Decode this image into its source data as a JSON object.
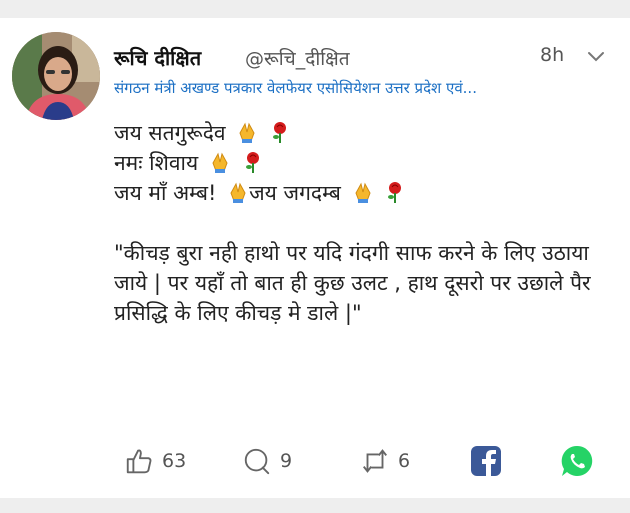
{
  "user": {
    "name": "रूचि दीक्षित",
    "handle": "@रूचि_दीक्षित",
    "time": "8h",
    "bio": "संगठन मंत्री अखण्ड पत्रकार वेलफेयर एसोसियेशन उत्तर प्रदेश एवं..."
  },
  "tweet": {
    "line1": "जय सतगुरूदेव",
    "line2": "नमः शिवाय",
    "line3a": "जय माँ अम्ब!",
    "line3b": "जय जगदम्ब",
    "quote": "\"कीचड़ बुरा नही हाथो पर यदि गंदगी साफ करने के लिए उठाया जाये | पर यहाँ तो बात ही कुछ उलट , हाथ दूसरो पर उछाले पैर प्रसिद्धि के लिए कीचड़ मे  डाले |\""
  },
  "actions": {
    "likes": "63",
    "replies": "9",
    "retweets": "6"
  },
  "icons": {
    "prayer": "folded-hands-icon",
    "rose": "rose-icon",
    "like": "thumbs-up-icon",
    "reply": "reply-icon",
    "retweet": "retweet-icon",
    "facebook": "facebook-icon",
    "whatsapp": "whatsapp-icon"
  },
  "colors": {
    "bio": "#1b6fc4",
    "facebook": "#3b5998",
    "whatsapp": "#25d366"
  }
}
